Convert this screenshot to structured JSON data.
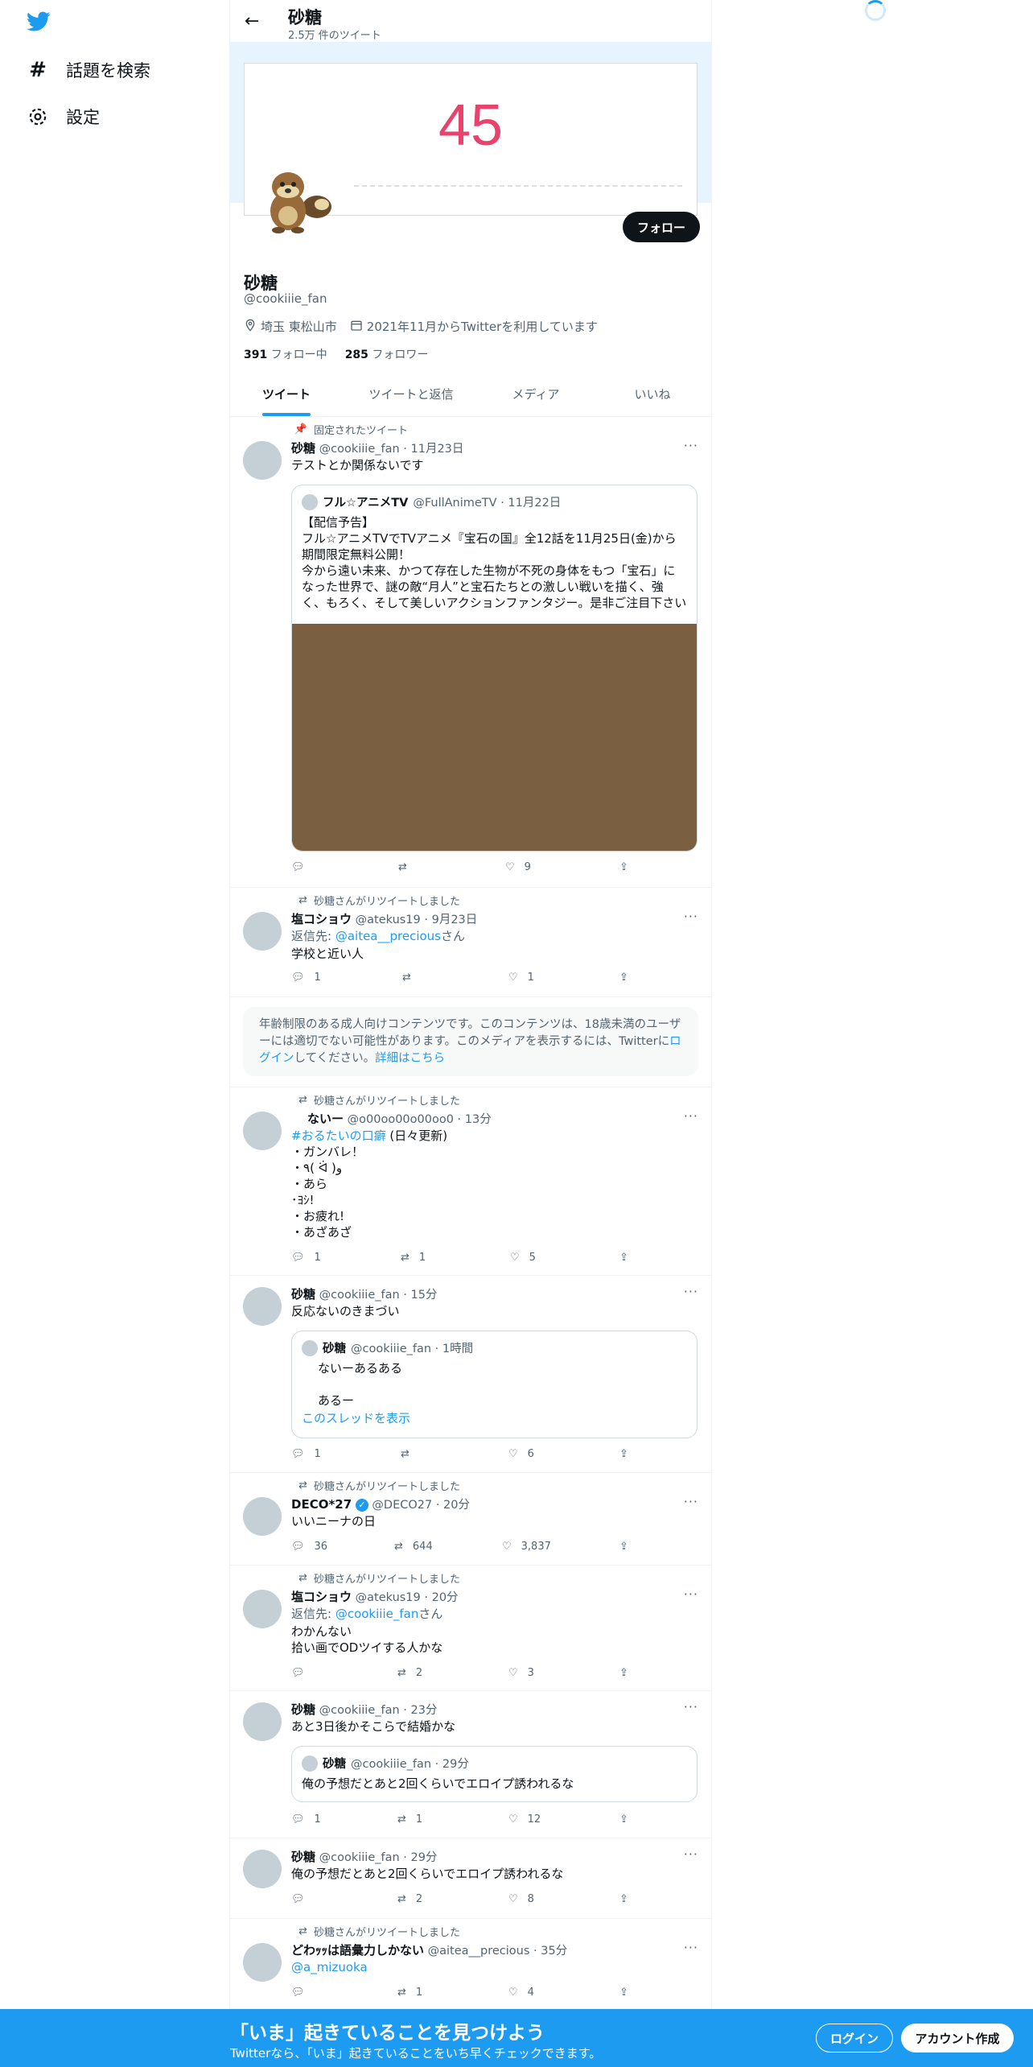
{
  "nav": {
    "explore": "話題を検索",
    "settings": "設定"
  },
  "header": {
    "title": "砂糖",
    "tweet_count": "2.5万 件のツイート"
  },
  "banner": {
    "number": "45"
  },
  "profile": {
    "follow": "フォロー",
    "name": "砂糖",
    "handle": "@cookiiie_fan",
    "location": "埼玉 東松山市",
    "joined": "2021年11月からTwitterを利用しています",
    "following_count": "391",
    "following_label": "フォロー中",
    "followers_count": "285",
    "followers_label": "フォロワー"
  },
  "tabs": [
    "ツイート",
    "ツイートと返信",
    "メディア",
    "いいね"
  ],
  "tweets": [
    {
      "context": "固定されたツイート",
      "name": "砂糖",
      "meta": "@cookiiie_fan · 11月23日",
      "text": "テストとか関係ないです",
      "quote": {
        "name": "フル☆アニメTV",
        "meta": "@FullAnimeTV · 11月22日",
        "text": "【配信予告】\nフル☆アニメTVでTVアニメ『宝石の国』全12話を11月25日(金)から期間限定無料公開！\n今から遠い未来、かつて存在した生物が不死の身体をもつ「宝石」になった世界で、謎の敵“月人”と宝石たちとの激しい戦いを描く、強く、もろく、そして美しいアクションファンタジー。是非ご注目下さい"
      },
      "reply": "",
      "retweet": "",
      "like": "9"
    },
    {
      "context": "砂糖さんがリツイートしました",
      "name": "塩コショウ",
      "meta": "@atekus19 · 9月23日",
      "reply_to_prefix": "返信先: ",
      "reply_to": "@aitea__precious",
      "reply_to_suffix": "さん",
      "text": "学校と近い人",
      "reply": "1",
      "retweet": "",
      "like": "1"
    },
    {
      "notice_pre": "年齢制限のある成人向けコンテンツです。このコンテンツは、18歳未満のユーザーには適切でない可能性があります。このメディアを表示するには、Twitterに",
      "notice_login": "ログイン",
      "notice_mid": "してください。",
      "notice_more": "詳細はこちら"
    },
    {
      "context": "砂糖さんがリツイートしました",
      "name": "ないー",
      "meta": "@o00oo00o00oo0 · 13分",
      "hashtag": "#おるたいの口癖",
      "hashtag_suffix": " (日々更新)",
      "text": "・ガンバレ！\n・٩( ᐛ )و\n・あら\n･ﾖｼ!\n・お疲れ!\n・あざあざ",
      "reply": "1",
      "retweet": "1",
      "like": "5"
    },
    {
      "name": "砂糖",
      "meta": "@cookiiie_fan · 15分",
      "text": "反応ないのきまづい",
      "quote": {
        "name": "砂糖",
        "meta": "@cookiiie_fan · 1時間",
        "text": "ないーあるある\n\nあるー",
        "thread": "このスレッドを表示"
      },
      "reply": "1",
      "retweet": "",
      "like": "6"
    },
    {
      "context": "砂糖さんがリツイートしました",
      "name": "DECO*27",
      "meta": "@DECO27 · 20分",
      "text": "いいニーナの日",
      "reply": "36",
      "retweet": "644",
      "like": "3,837"
    },
    {
      "context": "砂糖さんがリツイートしました",
      "name": "塩コショウ",
      "meta": "@atekus19 · 20分",
      "reply_to_prefix": "返信先: ",
      "reply_to": "@cookiiie_fan",
      "reply_to_suffix": "さん",
      "text": "わかんない\n拾い画でODツイする人かな",
      "reply": "",
      "retweet": "2",
      "like": "3"
    },
    {
      "name": "砂糖",
      "meta": "@cookiiie_fan · 23分",
      "text": "あと3日後かそこらで結婚かな",
      "quote": {
        "name": "砂糖",
        "meta": "@cookiiie_fan · 29分",
        "text": "俺の予想だとあと2回くらいでエロイプ誘われるな"
      },
      "reply": "1",
      "retweet": "1",
      "like": "12"
    },
    {
      "name": "砂糖",
      "meta": "@cookiiie_fan · 29分",
      "text": "俺の予想だとあと2回くらいでエロイプ誘われるな",
      "reply": "",
      "retweet": "2",
      "like": "8"
    },
    {
      "context": "砂糖さんがリツイートしました",
      "name": "どわｯｯは語彙力しかない",
      "meta": "@aitea__precious · 35分",
      "text": "@a_mizuoka",
      "reply": "",
      "retweet": "1",
      "like": "4"
    }
  ],
  "bottom": {
    "title": "「いま」起きていることを見つけよう",
    "subtitle": "Twitterなら、「いま」起きていることをいち早くチェックできます。",
    "login": "ログイン",
    "signup": "アカウント作成"
  },
  "colors": {
    "accent": "#1d9bf0",
    "banner_number": "#e8436d",
    "media": "#7a5f41"
  }
}
